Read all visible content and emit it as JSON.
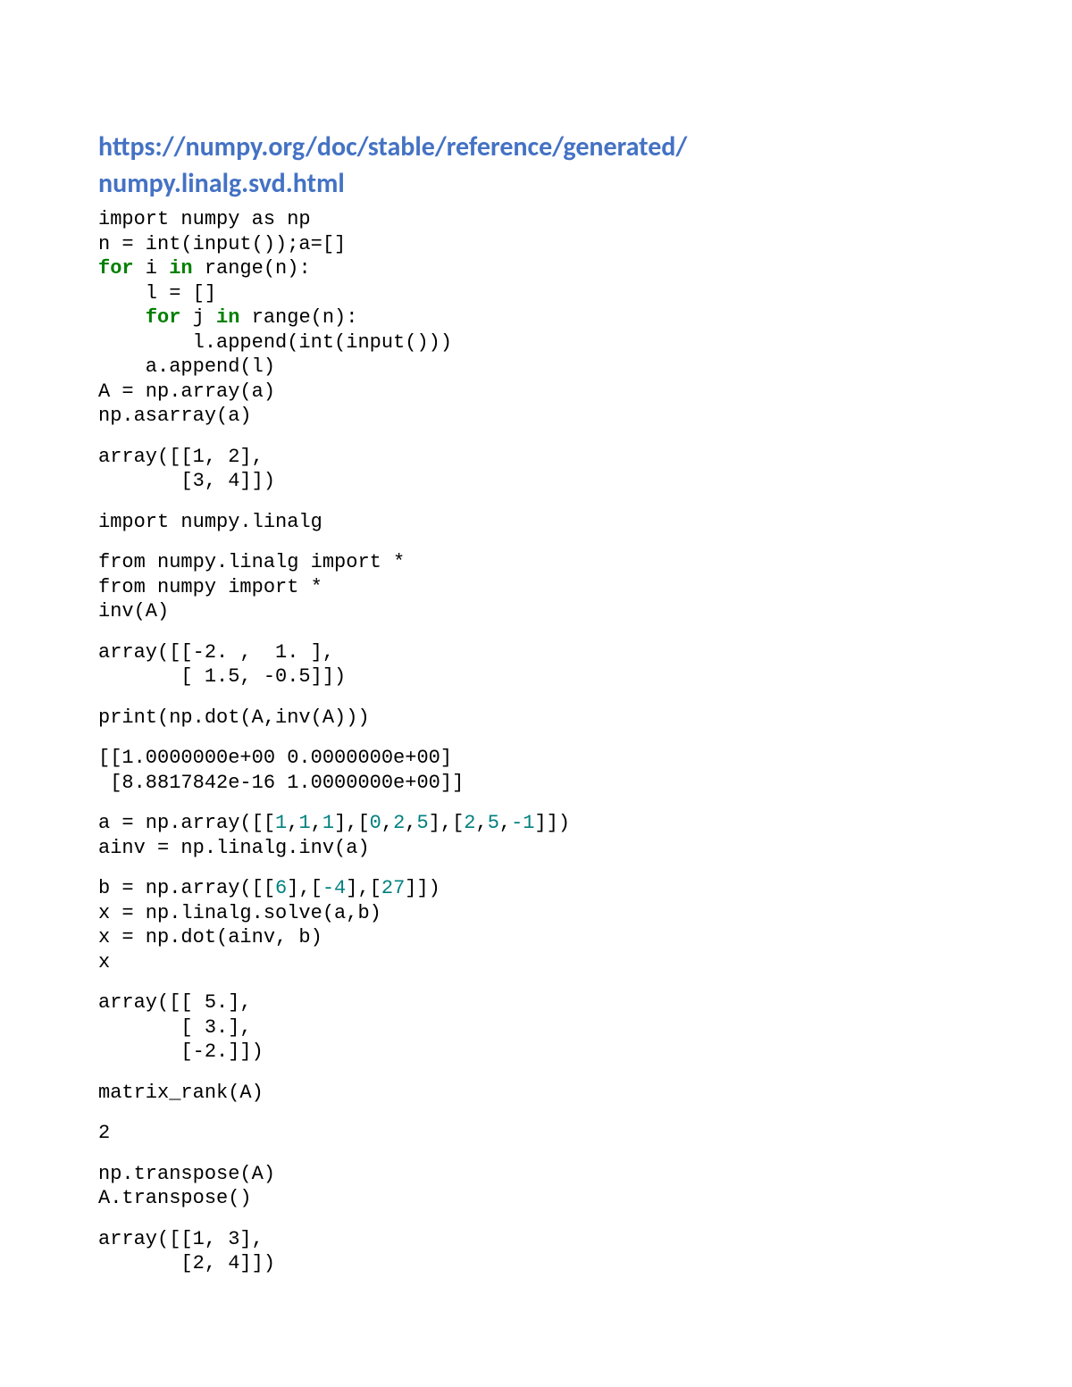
{
  "title_line1": "https://numpy.org/doc/stable/reference/generated/",
  "title_line2": "numpy.linalg.svd.html",
  "code": {
    "c1_l1a": "import numpy as np",
    "c1_l2a": "n = int(input());a=[]",
    "c1_l3_kw": "for",
    "c1_l3_mid": " i ",
    "c1_l3_kw2": "in",
    "c1_l3_rest": " range(n):",
    "c1_l4": "    l = []",
    "c1_l5_pre": "    ",
    "c1_l5_kw": "for",
    "c1_l5_mid": " j ",
    "c1_l5_kw2": "in",
    "c1_l5_rest": " range(n):",
    "c1_l6": "        l.append(int(input()))",
    "c1_l7": "    a.append(l)",
    "c1_l8": "A = np.array(a)",
    "c1_l9": "np.asarray(a)",
    "c2_l1": "array([[1, 2],",
    "c2_l2": "       [3, 4]])",
    "c3_l1": "import numpy.linalg",
    "c4_l1": "from numpy.linalg import *",
    "c4_l2": "from numpy import *",
    "c4_l3": "inv(A)",
    "c5_l1": "array([[-2. ,  1. ],",
    "c5_l2": "       [ 1.5, -0.5]])",
    "c6_l1": "print(np.dot(A,inv(A)))",
    "c7_l1": "[[1.0000000e+00 0.0000000e+00]",
    "c7_l2": " [8.8817842e-16 1.0000000e+00]]",
    "c8_l1_pre": "a = np.array([[",
    "c8_l1_n1": "1",
    "c8_l1_c1": ",",
    "c8_l1_n2": "1",
    "c8_l1_c2": ",",
    "c8_l1_n3": "1",
    "c8_l1_m1": "],[",
    "c8_l1_n4": "0",
    "c8_l1_c3": ",",
    "c8_l1_n5": "2",
    "c8_l1_c4": ",",
    "c8_l1_n6": "5",
    "c8_l1_m2": "],[",
    "c8_l1_n7": "2",
    "c8_l1_c5": ",",
    "c8_l1_n8": "5",
    "c8_l1_c6": ",",
    "c8_l1_n9": "-1",
    "c8_l1_end": "]])",
    "c8_l2": "ainv = np.linalg.inv(a)",
    "c9_l1_pre": "b = np.array([[",
    "c9_l1_n1": "6",
    "c9_l1_m1": "],[",
    "c9_l1_n2": "-4",
    "c9_l1_m2": "],[",
    "c9_l1_n3": "27",
    "c9_l1_end": "]])",
    "c9_l2": "x = np.linalg.solve(a,b)",
    "c9_l3": "x = np.dot(ainv, b)",
    "c9_l4": "x",
    "c10_l1": "array([[ 5.],",
    "c10_l2": "       [ 3.],",
    "c10_l3": "       [-2.]])",
    "c11_l1": "matrix_rank(A)",
    "c12_l1": "2",
    "c13_l1": "np.transpose(A)",
    "c13_l2": "A.transpose()",
    "c14_l1": "array([[1, 3],",
    "c14_l2": "       [2, 4]])"
  }
}
